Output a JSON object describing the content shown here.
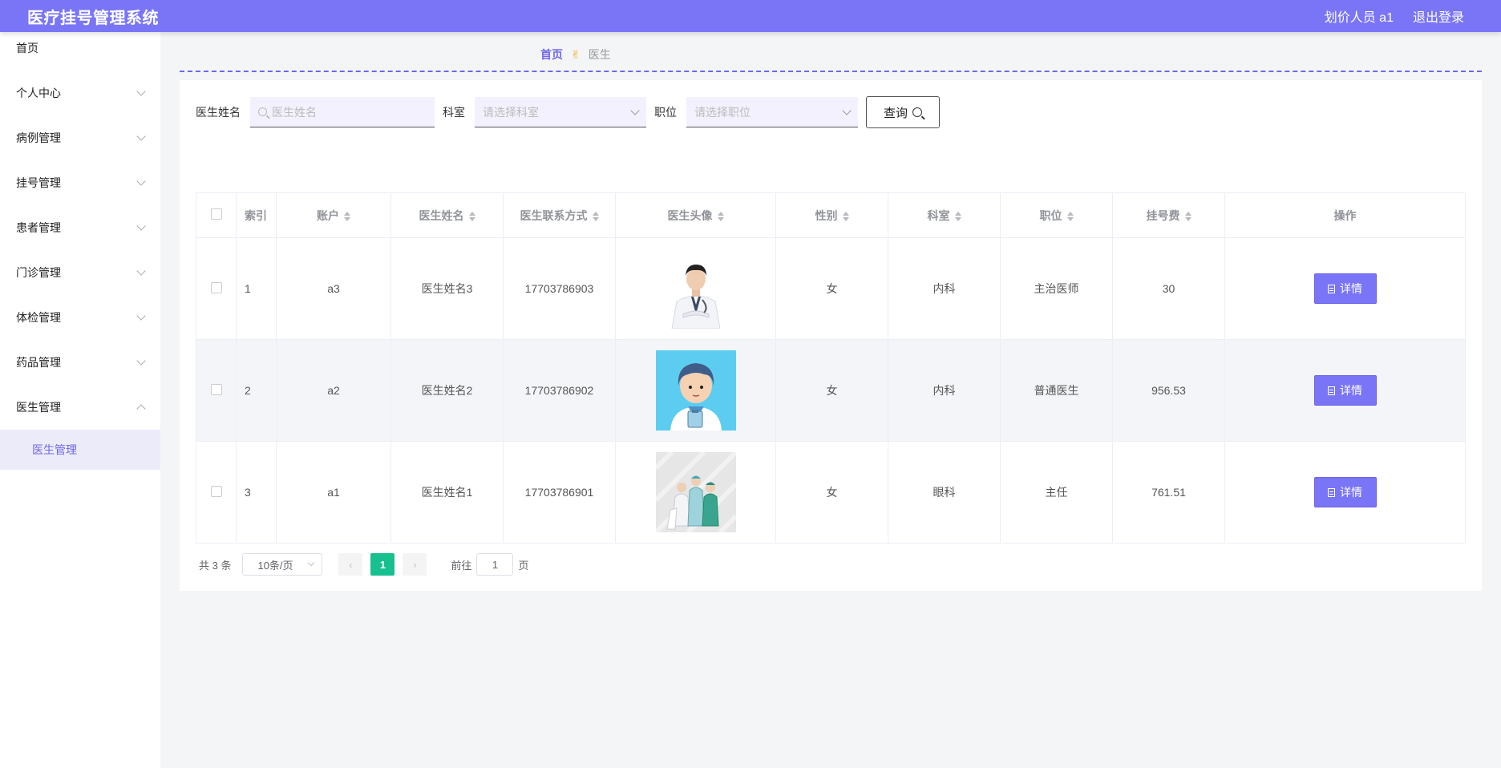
{
  "header": {
    "title": "医疗挂号管理系统",
    "user": "划价人员 a1",
    "logout": "退出登录"
  },
  "sidebar": {
    "items": [
      {
        "label": "首页",
        "expandable": false
      },
      {
        "label": "个人中心",
        "expandable": true
      },
      {
        "label": "病例管理",
        "expandable": true
      },
      {
        "label": "挂号管理",
        "expandable": true
      },
      {
        "label": "患者管理",
        "expandable": true
      },
      {
        "label": "门诊管理",
        "expandable": true
      },
      {
        "label": "体检管理",
        "expandable": true
      },
      {
        "label": "药品管理",
        "expandable": true
      },
      {
        "label": "医生管理",
        "expandable": true,
        "expanded": true
      }
    ],
    "submenu": {
      "label": "医生管理",
      "active": true
    }
  },
  "breadcrumb": {
    "home": "首页",
    "separator": "✌",
    "current": "医生"
  },
  "search": {
    "name_label": "医生姓名",
    "name_placeholder": "医生姓名",
    "dept_label": "科室",
    "dept_placeholder": "请选择科室",
    "position_label": "职位",
    "position_placeholder": "请选择职位",
    "query_button": "查询"
  },
  "table": {
    "headers": [
      "索引",
      "账户",
      "医生姓名",
      "医生联系方式",
      "医生头像",
      "性别",
      "科室",
      "职位",
      "挂号费",
      "操作"
    ],
    "rows": [
      {
        "index": "1",
        "account": "a3",
        "name": "医生姓名3",
        "phone": "17703786903",
        "avatar": "doctor-photo",
        "gender": "女",
        "dept": "内科",
        "position": "主治医师",
        "fee": "30",
        "action": "详情"
      },
      {
        "index": "2",
        "account": "a2",
        "name": "医生姓名2",
        "phone": "17703786902",
        "avatar": "cartoon-doctor",
        "gender": "女",
        "dept": "内科",
        "position": "普通医生",
        "fee": "956.53",
        "action": "详情"
      },
      {
        "index": "3",
        "account": "a1",
        "name": "医生姓名1",
        "phone": "17703786901",
        "avatar": "medical-team",
        "gender": "女",
        "dept": "眼科",
        "position": "主任",
        "fee": "761.51",
        "action": "详情"
      }
    ]
  },
  "pagination": {
    "total": "共 3 条",
    "page_size": "10条/页",
    "current_page": "1",
    "goto_label": "前往",
    "goto_value": "1",
    "page_suffix": "页"
  },
  "colors": {
    "primary": "#7a75f7",
    "active_page": "#18c08f",
    "sidebar_active_bg": "#ecebfa"
  }
}
